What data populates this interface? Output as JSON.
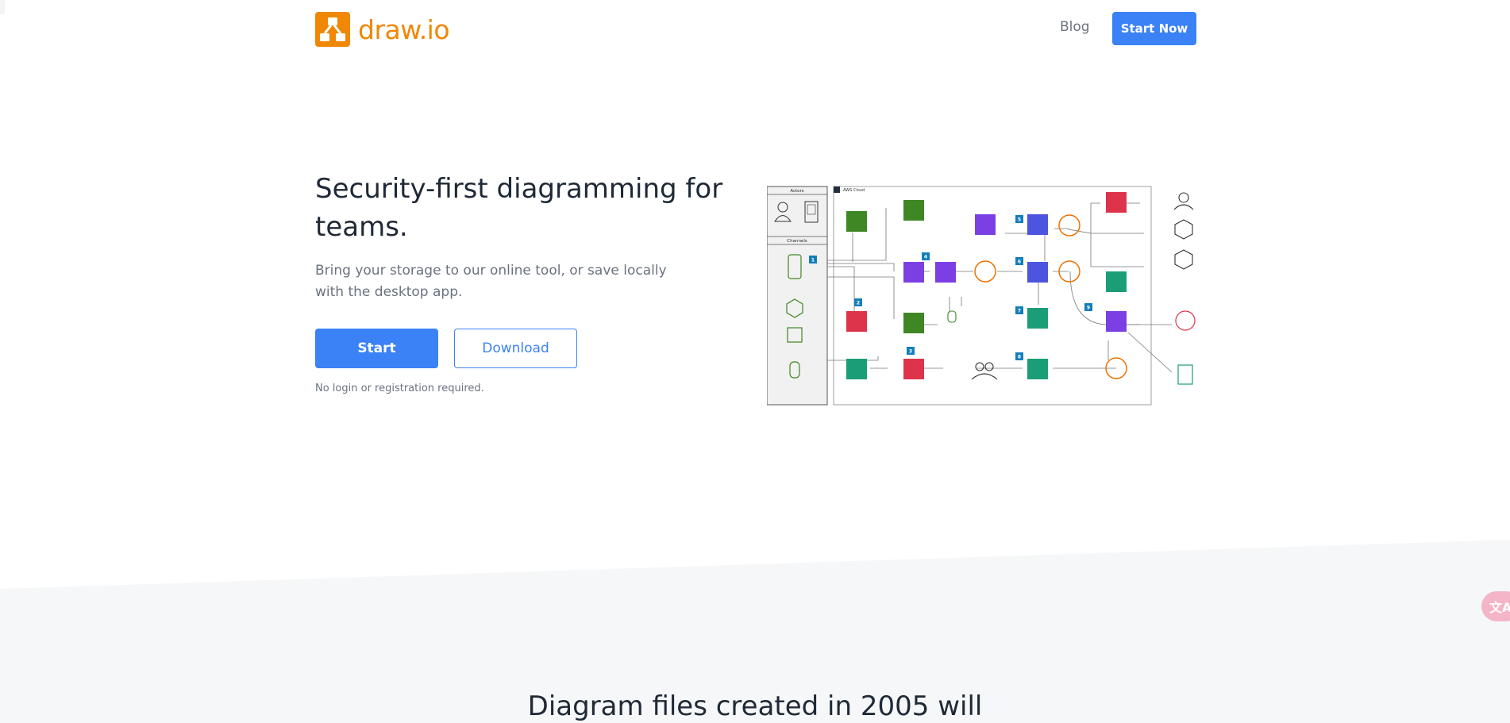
{
  "header": {
    "logo_text": "draw.io",
    "nav_blog": "Blog",
    "nav_start": "Start Now"
  },
  "hero": {
    "title": "Security-first diagramming for teams.",
    "subtitle": "Bring your storage to our online tool, or save locally with the desktop app.",
    "start_label": "Start",
    "download_label": "Download",
    "note": "No login or registration required."
  },
  "diagram": {
    "actors_label": "Actors",
    "channels_label": "Channels",
    "cloud_label": "AWS Cloud",
    "steps": [
      "1",
      "2",
      "3",
      "4",
      "5",
      "6",
      "7",
      "8",
      "9"
    ]
  },
  "section": {
    "title": "Diagram files created in 2005 will"
  },
  "widgets": {
    "translate_icon": "translate-icon"
  },
  "colors": {
    "accent": "#3b82f6",
    "brand": "#f08705",
    "aws_green": "#3f8624",
    "aws_purple": "#7b3fe4",
    "aws_orange": "#ed7100",
    "aws_red": "#dd344c",
    "aws_teal": "#1b9e77",
    "aws_indigo": "#4d54e0"
  }
}
